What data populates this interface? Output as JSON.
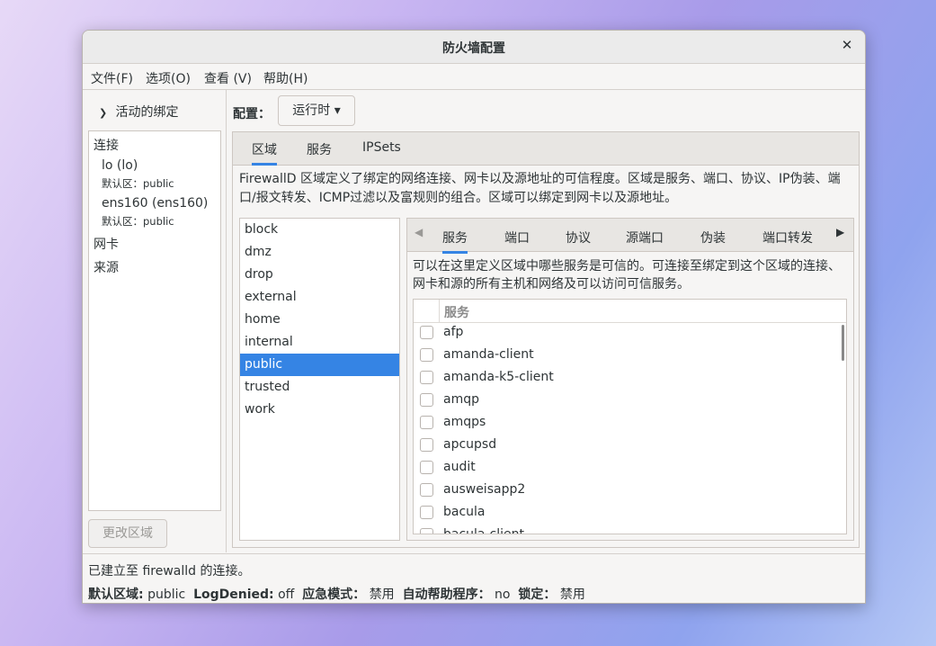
{
  "window": {
    "title": "防火墙配置"
  },
  "menu": [
    "文件(F)",
    "选项(O)",
    "查看 (V)",
    "帮助(H)"
  ],
  "sidebar": {
    "expander_label": "活动的绑定",
    "sections": {
      "connections": "连接",
      "nic": "网卡",
      "sources": "来源"
    },
    "connections": [
      {
        "name": "lo (lo)",
        "zone": "默认区：public"
      },
      {
        "name": "ens160 (ens160)",
        "zone": "默认区：public"
      }
    ],
    "change_zone_button": "更改区域"
  },
  "config": {
    "label": "配置：",
    "value": "运行时"
  },
  "tabs": [
    "区域",
    "服务",
    "IPSets"
  ],
  "zone_description": "FirewallD 区域定义了绑定的网络连接、网卡以及源地址的可信程度。区域是服务、端口、协议、IP伪装、端口/报文转发、ICMP过滤以及富规则的组合。区域可以绑定到网卡以及源地址。",
  "zones": [
    "block",
    "dmz",
    "drop",
    "external",
    "home",
    "internal",
    "public",
    "trusted",
    "work"
  ],
  "selected_zone": "public",
  "subtabs": [
    "服务",
    "端口",
    "协议",
    "源端口",
    "伪装",
    "端口转发"
  ],
  "services_description": "可以在这里定义区域中哪些服务是可信的。可连接至绑定到这个区域的连接、网卡和源的所有主机和网络及可以访问可信服务。",
  "services_header": "服务",
  "services": [
    "afp",
    "amanda-client",
    "amanda-k5-client",
    "amqp",
    "amqps",
    "apcupsd",
    "audit",
    "ausweisapp2",
    "bacula",
    "bacula-client"
  ],
  "status": {
    "connection": "已建立至 firewalld 的连接。",
    "default_zone_label": "默认区域:",
    "default_zone_value": "public",
    "logdenied_label": "LogDenied:",
    "logdenied_value": "off",
    "panic_label": "应急模式：",
    "panic_value": "禁用",
    "autohelper_label": "自动帮助程序：",
    "autohelper_value": "no",
    "lock_label": "锁定：",
    "lock_value": "禁用"
  },
  "colors": {
    "accent": "#3584e4"
  }
}
